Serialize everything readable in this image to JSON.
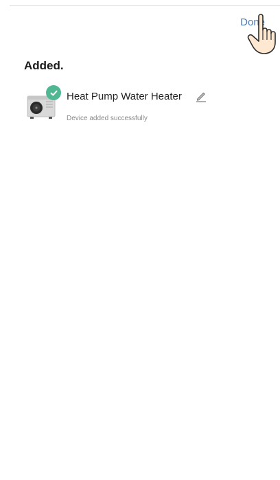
{
  "header": {
    "done_label": "Done"
  },
  "section": {
    "title": "Added."
  },
  "device": {
    "name": "Heat Pump Water Heater",
    "status": "Device added successfully",
    "icon": "heat-pump-unit",
    "badge_icon": "check-icon",
    "badge_color": "#4fb893"
  },
  "colors": {
    "link": "#4a7bb8",
    "success": "#4fb893"
  }
}
